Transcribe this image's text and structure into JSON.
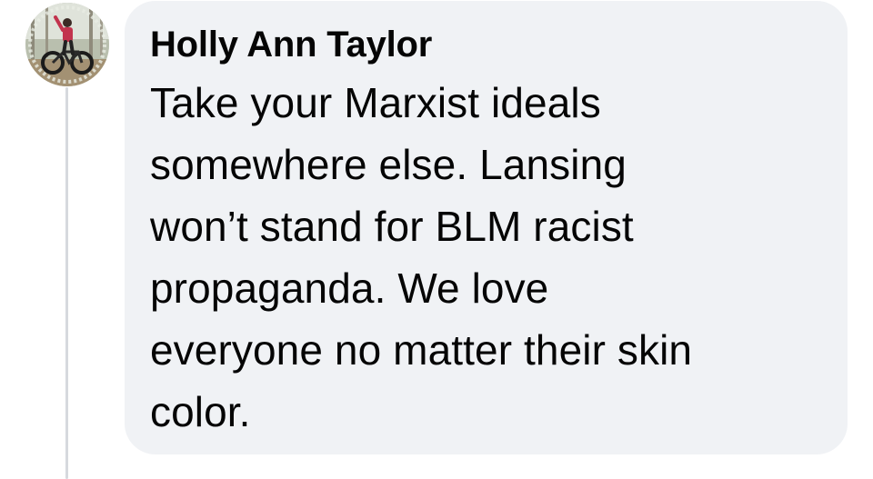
{
  "comment": {
    "author": "Holly Ann Taylor",
    "text": "Take your Marxist ideals\nsomewhere else. Lansing\nwon’t stand for BLM racist\npropaganda. We love\neveryone no matter their skin\ncolor.",
    "avatar_icon": "profile-photo-cyclist-with-bike"
  },
  "colors": {
    "bubble_bg": "#f0f2f5",
    "text": "#050505",
    "thread_line": "#d6d9de"
  }
}
